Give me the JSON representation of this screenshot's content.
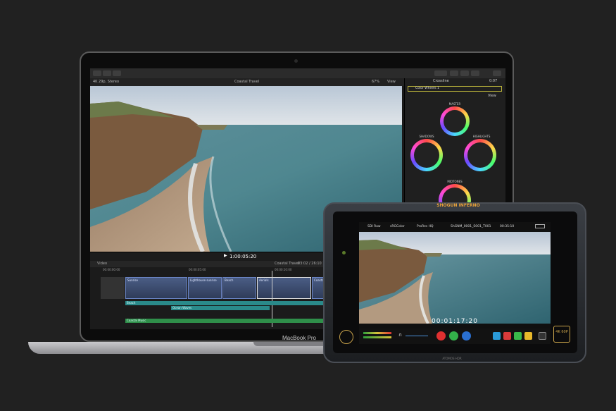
{
  "laptop": {
    "brand": "MacBook Pro"
  },
  "fcp": {
    "library": "4K 29p, Stereo",
    "project_title": "Coastal Travel",
    "zoom": "67%",
    "view_label": "View",
    "inspector_tab": "Crossline",
    "inspector_value": "0:07",
    "effect_name": "Color Wheels 1",
    "inspector_view": "View",
    "wheels": [
      "MASTER",
      "SHADOWS",
      "HIGHLIGHTS",
      "MIDTONES"
    ],
    "timecode": "1:00:05:20",
    "timeline_label": "Video",
    "timeline_project": "Coastal Travel",
    "timeline_duration": "03:02 / 26:10",
    "ruler": [
      "00:00:00:00",
      "00:00:05:00",
      "00:00:10:00"
    ],
    "clips": [
      "Sunrise",
      "Lighthouse sunrise",
      "Beach",
      "Aerials",
      "Coastal"
    ],
    "audio": [
      "Beach",
      "Ocean Waves",
      "Coastal Music"
    ]
  },
  "monitor": {
    "brand_banner": "SHOGUN INFERNO",
    "badge": "4K 60P",
    "bottom_brand": "ATOMOS HDR",
    "status": [
      "SDI Raw",
      "sRGColor",
      "ProRes HQ",
      "ShGNM_0001_S001_T001",
      "00:35:10"
    ],
    "timecode": "00:01:17:20"
  },
  "colors": {
    "accent_blue": "#6b86c7",
    "audio_teal": "#2a8a8a",
    "music_green": "#2f8f4a",
    "rec_red": "#e03030",
    "play_green": "#33b04a"
  },
  "icons": [
    "apple-logo-icon",
    "record-icon",
    "play-icon",
    "stop-icon",
    "headphones-icon",
    "flag-icon",
    "settings-icon"
  ]
}
